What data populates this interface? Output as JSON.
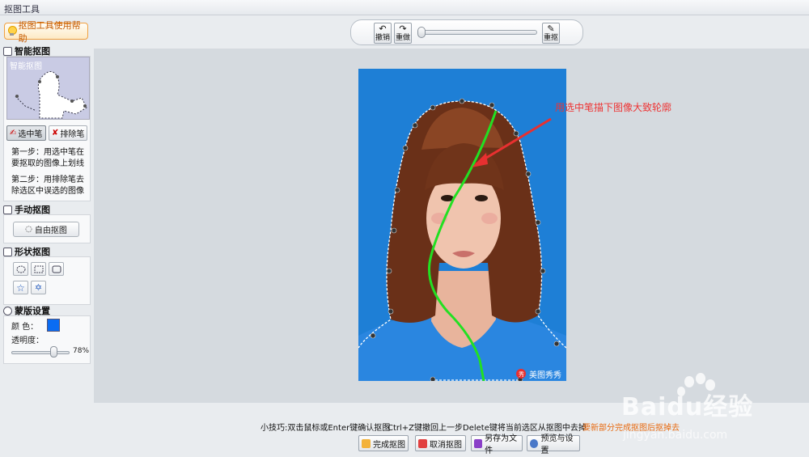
{
  "window": {
    "title": "抠图工具"
  },
  "help_button": {
    "label": "抠图工具使用帮助"
  },
  "toolbar": {
    "undo_label": "撤销",
    "redo_label": "重做",
    "reset_label": "重抠"
  },
  "sidebar": {
    "smart": {
      "title": "智能抠图",
      "preview_label": "智能抠图",
      "select_pen": "选中笔",
      "erase_pen": "排除笔",
      "step1": "第一步：用选中笔在要抠取的图像上划线",
      "step2": "第二步：用排除笔去除选区中误选的图像"
    },
    "manual": {
      "title": "手动抠图",
      "free_button": "自由抠图"
    },
    "shape": {
      "title": "形状抠图"
    },
    "mask": {
      "title": "蒙版设置",
      "color_label": "颜  色：",
      "color_value": "#0a6cf2",
      "opacity_label": "透明度：",
      "opacity_value": "78%"
    }
  },
  "canvas": {
    "annotation": "用选中笔描下图像大致轮廓",
    "photo_watermark": "美图秀秀",
    "colors": {
      "background": "#1e7fd6",
      "stroke": "#22e022",
      "arrow": "#e83030"
    }
  },
  "footer": {
    "tip1": "小技巧:双击鼠标或Enter键确认抠图",
    "tip2": "Ctrl+Z键撤回上一步",
    "tip3": "Delete键将当前选区从抠图中去掉",
    "tip4": "要新部分完成抠图后抠掉去",
    "buttons": {
      "finish": "完成抠图",
      "cancel": "取消抠图",
      "save": "另存为文件",
      "preview": "预览与设置"
    }
  },
  "watermark": {
    "brand": "Baidu经验",
    "url": "jingyan.baidu.com"
  }
}
